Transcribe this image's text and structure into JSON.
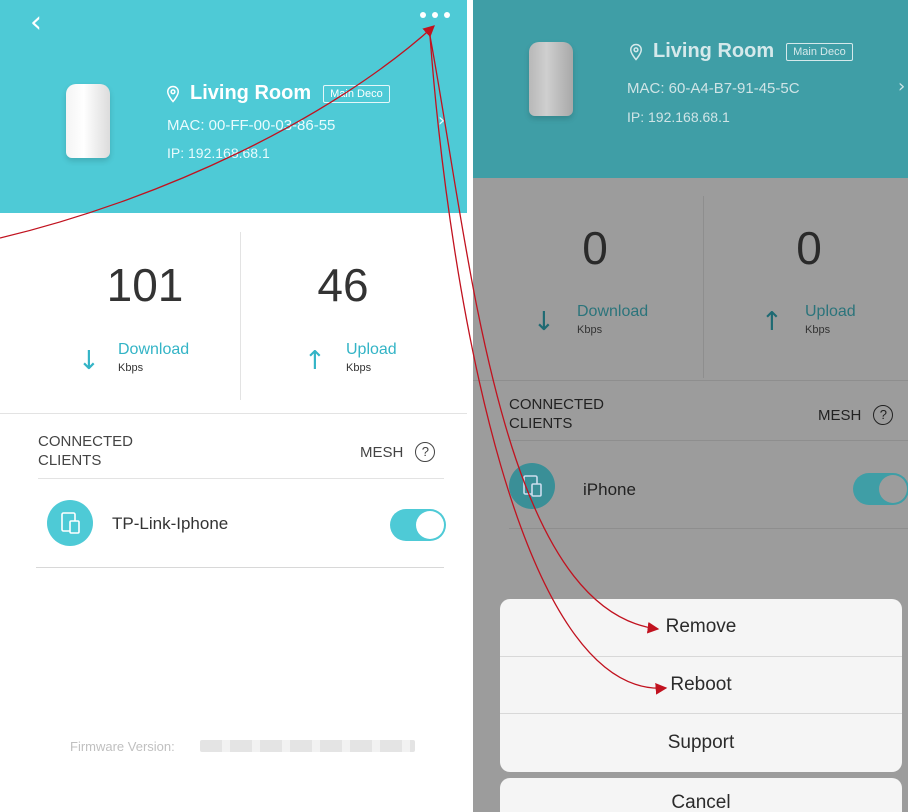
{
  "left": {
    "location": "Living Room",
    "tag": "Main Deco",
    "mac": "MAC: 00-FF-00-03-86-55",
    "ip": "IP: 192.168.68.1",
    "download_value": "101",
    "upload_value": "46",
    "download_label": "Download",
    "upload_label": "Upload",
    "unit": "Kbps",
    "section_title": "CONNECTED\nCLIENTS",
    "mesh_label": "MESH",
    "client_name": "TP-Link-Iphone",
    "firmware_label": "Firmware Version:"
  },
  "right": {
    "location": "Living Room",
    "tag": "Main Deco",
    "mac": "MAC: 60-A4-B7-91-45-5C",
    "ip": "IP: 192.168.68.1",
    "download_value": "0",
    "upload_value": "0",
    "download_label": "Download",
    "upload_label": "Upload",
    "unit": "Kbps",
    "section_title": "CONNECTED\nCLIENTS",
    "mesh_label": "MESH",
    "client_name": "iPhone",
    "sheet_options": [
      "Remove",
      "Reboot",
      "Support"
    ],
    "cancel_label": "Cancel"
  },
  "colors": {
    "accent": "#4ecad6",
    "annotation_arrow": "#c1121f"
  },
  "icons": {
    "back": "chevron-left-icon",
    "more": "more-dots-icon",
    "location": "location-pin-icon",
    "download": "arrow-down-icon",
    "upload": "arrow-up-icon",
    "help": "question-circle-icon",
    "client": "devices-icon"
  }
}
